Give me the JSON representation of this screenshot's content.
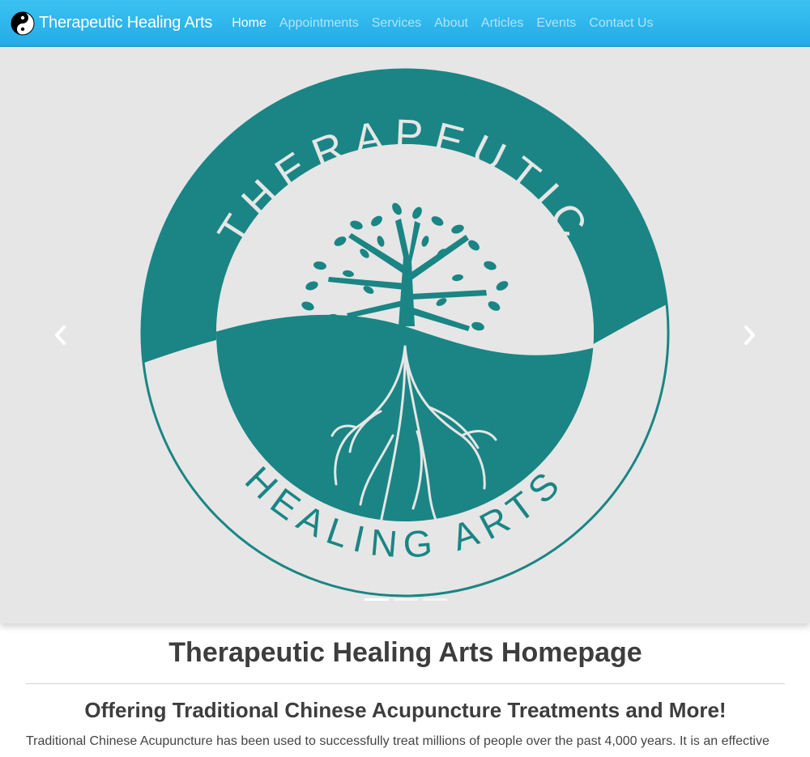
{
  "colors": {
    "navbar": "#2bb4ea",
    "teal": "#1a8584",
    "carousel_bg": "#e6e6e6",
    "heading": "#3d3d3d"
  },
  "navbar": {
    "brand_icon": "yin-yang-icon",
    "brand": "Therapeutic Healing Arts",
    "items": [
      {
        "label": "Home",
        "active": true
      },
      {
        "label": "Appointments",
        "active": false
      },
      {
        "label": "Services",
        "active": false
      },
      {
        "label": "About",
        "active": false
      },
      {
        "label": "Articles",
        "active": false
      },
      {
        "label": "Events",
        "active": false
      },
      {
        "label": "Contact Us",
        "active": false
      }
    ]
  },
  "carousel": {
    "logo": {
      "top_text": "THERAPEUTIC",
      "bottom_text": "HEALING ARTS"
    },
    "prev_icon": "chevron-left-icon",
    "next_icon": "chevron-right-icon",
    "slide_count": 3,
    "active_slide": 1
  },
  "main": {
    "title": "Therapeutic Healing Arts Homepage",
    "subtitle": "Offering Traditional Chinese Acupuncture Treatments and More!",
    "intro": "Traditional Chinese Acupuncture has been used to successfully treat millions of people over the past 4,000 years. It is an effective"
  }
}
